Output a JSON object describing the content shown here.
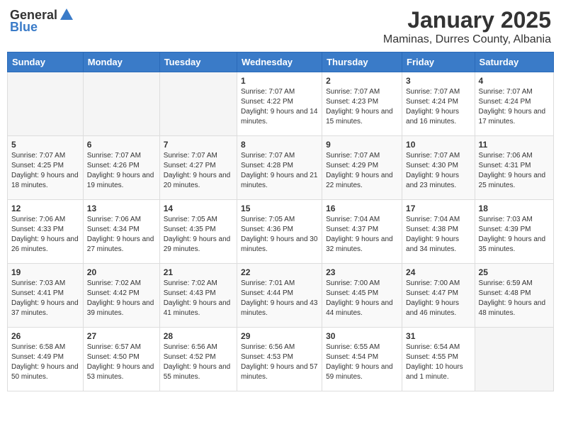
{
  "header": {
    "logo_general": "General",
    "logo_blue": "Blue",
    "title": "January 2025",
    "subtitle": "Maminas, Durres County, Albania"
  },
  "days_of_week": [
    "Sunday",
    "Monday",
    "Tuesday",
    "Wednesday",
    "Thursday",
    "Friday",
    "Saturday"
  ],
  "weeks": [
    [
      {
        "day": "",
        "empty": true
      },
      {
        "day": "",
        "empty": true
      },
      {
        "day": "",
        "empty": true
      },
      {
        "day": "1",
        "sunrise": "7:07 AM",
        "sunset": "4:22 PM",
        "daylight": "9 hours and 14 minutes."
      },
      {
        "day": "2",
        "sunrise": "7:07 AM",
        "sunset": "4:23 PM",
        "daylight": "9 hours and 15 minutes."
      },
      {
        "day": "3",
        "sunrise": "7:07 AM",
        "sunset": "4:24 PM",
        "daylight": "9 hours and 16 minutes."
      },
      {
        "day": "4",
        "sunrise": "7:07 AM",
        "sunset": "4:24 PM",
        "daylight": "9 hours and 17 minutes."
      }
    ],
    [
      {
        "day": "5",
        "sunrise": "7:07 AM",
        "sunset": "4:25 PM",
        "daylight": "9 hours and 18 minutes."
      },
      {
        "day": "6",
        "sunrise": "7:07 AM",
        "sunset": "4:26 PM",
        "daylight": "9 hours and 19 minutes."
      },
      {
        "day": "7",
        "sunrise": "7:07 AM",
        "sunset": "4:27 PM",
        "daylight": "9 hours and 20 minutes."
      },
      {
        "day": "8",
        "sunrise": "7:07 AM",
        "sunset": "4:28 PM",
        "daylight": "9 hours and 21 minutes."
      },
      {
        "day": "9",
        "sunrise": "7:07 AM",
        "sunset": "4:29 PM",
        "daylight": "9 hours and 22 minutes."
      },
      {
        "day": "10",
        "sunrise": "7:07 AM",
        "sunset": "4:30 PM",
        "daylight": "9 hours and 23 minutes."
      },
      {
        "day": "11",
        "sunrise": "7:06 AM",
        "sunset": "4:31 PM",
        "daylight": "9 hours and 25 minutes."
      }
    ],
    [
      {
        "day": "12",
        "sunrise": "7:06 AM",
        "sunset": "4:33 PM",
        "daylight": "9 hours and 26 minutes."
      },
      {
        "day": "13",
        "sunrise": "7:06 AM",
        "sunset": "4:34 PM",
        "daylight": "9 hours and 27 minutes."
      },
      {
        "day": "14",
        "sunrise": "7:05 AM",
        "sunset": "4:35 PM",
        "daylight": "9 hours and 29 minutes."
      },
      {
        "day": "15",
        "sunrise": "7:05 AM",
        "sunset": "4:36 PM",
        "daylight": "9 hours and 30 minutes."
      },
      {
        "day": "16",
        "sunrise": "7:04 AM",
        "sunset": "4:37 PM",
        "daylight": "9 hours and 32 minutes."
      },
      {
        "day": "17",
        "sunrise": "7:04 AM",
        "sunset": "4:38 PM",
        "daylight": "9 hours and 34 minutes."
      },
      {
        "day": "18",
        "sunrise": "7:03 AM",
        "sunset": "4:39 PM",
        "daylight": "9 hours and 35 minutes."
      }
    ],
    [
      {
        "day": "19",
        "sunrise": "7:03 AM",
        "sunset": "4:41 PM",
        "daylight": "9 hours and 37 minutes."
      },
      {
        "day": "20",
        "sunrise": "7:02 AM",
        "sunset": "4:42 PM",
        "daylight": "9 hours and 39 minutes."
      },
      {
        "day": "21",
        "sunrise": "7:02 AM",
        "sunset": "4:43 PM",
        "daylight": "9 hours and 41 minutes."
      },
      {
        "day": "22",
        "sunrise": "7:01 AM",
        "sunset": "4:44 PM",
        "daylight": "9 hours and 43 minutes."
      },
      {
        "day": "23",
        "sunrise": "7:00 AM",
        "sunset": "4:45 PM",
        "daylight": "9 hours and 44 minutes."
      },
      {
        "day": "24",
        "sunrise": "7:00 AM",
        "sunset": "4:47 PM",
        "daylight": "9 hours and 46 minutes."
      },
      {
        "day": "25",
        "sunrise": "6:59 AM",
        "sunset": "4:48 PM",
        "daylight": "9 hours and 48 minutes."
      }
    ],
    [
      {
        "day": "26",
        "sunrise": "6:58 AM",
        "sunset": "4:49 PM",
        "daylight": "9 hours and 50 minutes."
      },
      {
        "day": "27",
        "sunrise": "6:57 AM",
        "sunset": "4:50 PM",
        "daylight": "9 hours and 53 minutes."
      },
      {
        "day": "28",
        "sunrise": "6:56 AM",
        "sunset": "4:52 PM",
        "daylight": "9 hours and 55 minutes."
      },
      {
        "day": "29",
        "sunrise": "6:56 AM",
        "sunset": "4:53 PM",
        "daylight": "9 hours and 57 minutes."
      },
      {
        "day": "30",
        "sunrise": "6:55 AM",
        "sunset": "4:54 PM",
        "daylight": "9 hours and 59 minutes."
      },
      {
        "day": "31",
        "sunrise": "6:54 AM",
        "sunset": "4:55 PM",
        "daylight": "10 hours and 1 minute."
      },
      {
        "day": "",
        "empty": true
      }
    ]
  ]
}
